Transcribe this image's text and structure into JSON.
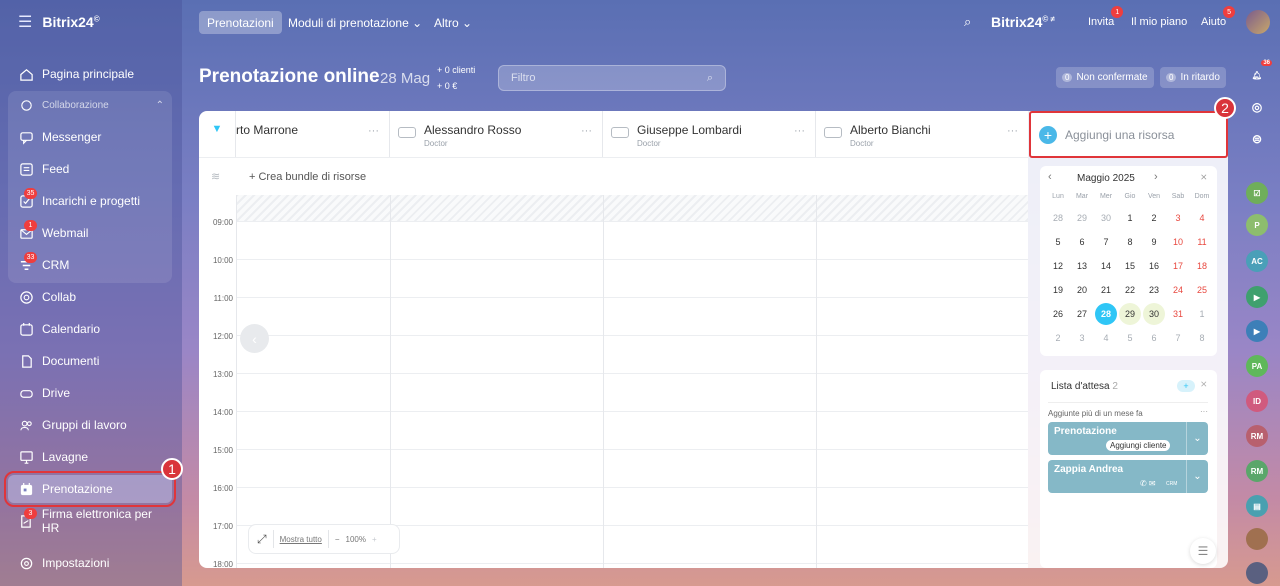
{
  "app": {
    "name": "Bitrix24",
    "logo_mark": "©"
  },
  "sidebar": {
    "items": [
      {
        "label": "Pagina principale",
        "icon": "home-icon"
      },
      {
        "label": "Collaborazione",
        "icon": "collab-group-icon"
      },
      {
        "label": "Messenger",
        "icon": "chat-icon"
      },
      {
        "label": "Feed",
        "icon": "feed-icon"
      },
      {
        "label": "Incarichi e progetti",
        "icon": "tasks-icon",
        "badge": "35"
      },
      {
        "label": "Webmail",
        "icon": "mail-icon",
        "badge": "1"
      },
      {
        "label": "CRM",
        "icon": "crm-icon",
        "badge": "33"
      },
      {
        "label": "Collab",
        "icon": "collab-icon"
      },
      {
        "label": "Calendario",
        "icon": "calendar-icon"
      },
      {
        "label": "Documenti",
        "icon": "document-icon"
      },
      {
        "label": "Drive",
        "icon": "drive-icon"
      },
      {
        "label": "Gruppi di lavoro",
        "icon": "groups-icon"
      },
      {
        "label": "Lavagne",
        "icon": "board-icon"
      },
      {
        "label": "Prenotazione",
        "icon": "booking-icon"
      },
      {
        "label": "Firma elettronica per HR",
        "icon": "signature-icon",
        "badge": "3"
      },
      {
        "label": "Impostazioni",
        "icon": "settings-icon"
      }
    ],
    "callout": "1"
  },
  "topbar": {
    "tabs": [
      "Prenotazioni",
      "Moduli di prenotazione ⌄",
      "Altro ⌄"
    ],
    "brand": "Bitrix24",
    "invite": "Invita",
    "invite_badge": "1",
    "plan": "Il mio piano",
    "help": "Aiuto",
    "help_badge": "5"
  },
  "header": {
    "title": "Prenotazione online",
    "date": "28 Mag",
    "clients": "+ 0 clienti",
    "revenue": "+ 0 €",
    "filter_placeholder": "Filtro",
    "unconfirmed": "Non confermate",
    "unconfirmed_count": "0",
    "late": "In ritardo",
    "late_count": "0"
  },
  "resources": [
    {
      "name": "rto Marrone",
      "role": ""
    },
    {
      "name": "Alessandro Rosso",
      "role": "Doctor"
    },
    {
      "name": "Giuseppe Lombardi",
      "role": "Doctor"
    },
    {
      "name": "Alberto Bianchi",
      "role": "Doctor"
    }
  ],
  "bundle_label": "+ Crea bundle di risorse",
  "hours": [
    "09:00",
    "10:00",
    "11:00",
    "12:00",
    "13:00",
    "14:00",
    "15:00",
    "16:00",
    "17:00",
    "18:00"
  ],
  "zoom": {
    "show_all": "Mostra tutto",
    "level": "100%"
  },
  "add_resource": "Aggiungi una risorsa",
  "add_resource_callout": "2",
  "calendar": {
    "month": "Maggio 2025",
    "weekdays": [
      "Lun",
      "Mar",
      "Mer",
      "Gio",
      "Ven",
      "Sab",
      "Dom"
    ],
    "weeks": [
      [
        "28",
        "29",
        "30",
        "1",
        "2",
        "3",
        "4"
      ],
      [
        "5",
        "6",
        "7",
        "8",
        "9",
        "10",
        "11"
      ],
      [
        "12",
        "13",
        "14",
        "15",
        "16",
        "17",
        "18"
      ],
      [
        "19",
        "20",
        "21",
        "22",
        "23",
        "24",
        "25"
      ],
      [
        "26",
        "27",
        "28",
        "29",
        "30",
        "31",
        "1"
      ],
      [
        "2",
        "3",
        "4",
        "5",
        "6",
        "7",
        "8"
      ]
    ],
    "today": "28"
  },
  "waitlist": {
    "title": "Lista d'attesa",
    "count": "2",
    "section": "Aggiunte più di un mese fa",
    "cards": [
      {
        "title": "Prenotazione",
        "action": "Aggiungi cliente"
      },
      {
        "title": "Zappia Andrea",
        "action": "CRM"
      }
    ]
  },
  "right_column": {
    "notif_badge": "36",
    "avatars": [
      "P",
      "AC",
      "PA",
      "ID",
      "RM",
      "RM"
    ]
  }
}
